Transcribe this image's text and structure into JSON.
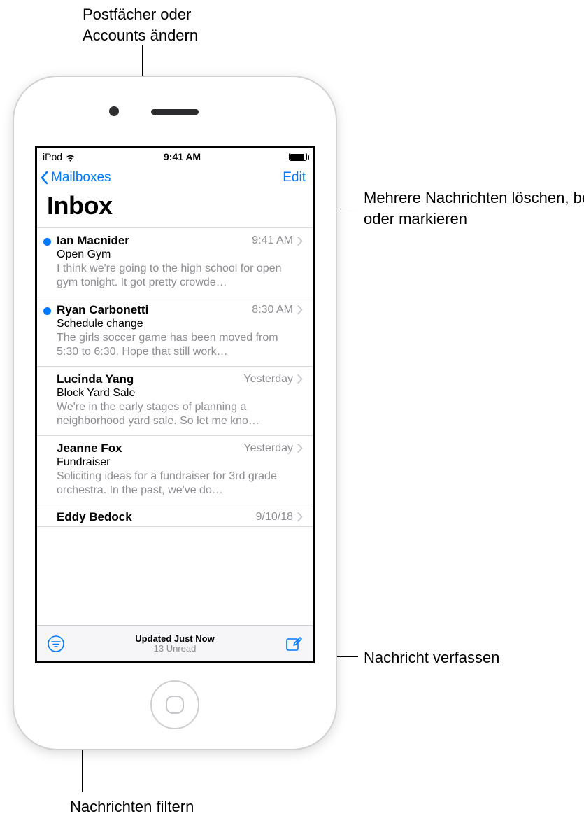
{
  "callouts": {
    "top": "Postfächer oder\nAccounts ändern",
    "edit": "Mehrere Nachrichten löschen, bewegen\noder markieren",
    "compose": "Nachricht verfassen",
    "filter": "Nachrichten filtern"
  },
  "status": {
    "carrier": "iPod",
    "time": "9:41 AM"
  },
  "nav": {
    "back": "Mailboxes",
    "edit": "Edit"
  },
  "title": "Inbox",
  "messages": [
    {
      "unread": true,
      "sender": "Ian Macnider",
      "time": "9:41 AM",
      "subject": "Open Gym",
      "preview": "I think we're going to the high school for open gym tonight. It got pretty crowde…"
    },
    {
      "unread": true,
      "sender": "Ryan Carbonetti",
      "time": "8:30 AM",
      "subject": "Schedule change",
      "preview": "The girls soccer game has been moved from 5:30 to 6:30. Hope that still work…"
    },
    {
      "unread": false,
      "sender": "Lucinda Yang",
      "time": "Yesterday",
      "subject": "Block Yard Sale",
      "preview": "We're in the early stages of planning a neighborhood yard sale. So let me kno…"
    },
    {
      "unread": false,
      "sender": "Jeanne Fox",
      "time": "Yesterday",
      "subject": "Fundraiser",
      "preview": "Soliciting ideas for a fundraiser for 3rd grade orchestra. In the past, we've do…"
    },
    {
      "unread": false,
      "sender": "Eddy Bedock",
      "time": "9/10/18",
      "subject": "",
      "preview": ""
    }
  ],
  "toolbar": {
    "updated": "Updated Just Now",
    "unread": "13 Unread"
  }
}
